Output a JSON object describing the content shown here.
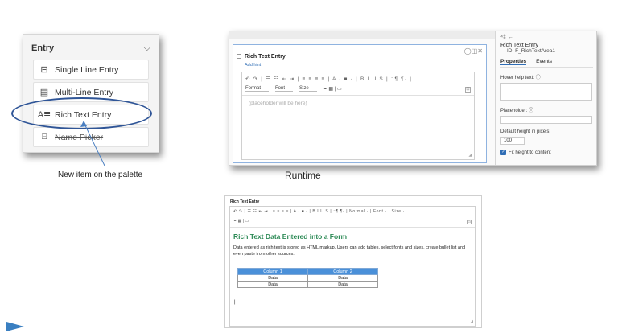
{
  "palette": {
    "title": "Entry",
    "chevron": "⌵",
    "items": [
      {
        "label": "Single Line Entry",
        "icon": "⊟"
      },
      {
        "label": "Multi-Line Entry",
        "icon": "▤"
      },
      {
        "label": "Rich Text Entry",
        "icon": "A≣"
      },
      {
        "label": "Name Picker",
        "icon": "⌸"
      }
    ],
    "caption": "New item on the palette",
    "highlight_color": "#2f5597"
  },
  "designer": {
    "top_icons": "◯◫✕",
    "field_label": "Rich Text Entry",
    "add_hint": "Add hint",
    "toolbar_row1": "↶ ↷ | ☰ ☷ ⇤ ⇥ | ≡ ≡ ≡ ≡ | A · ■ · | B I U S | ⁻¶ ¶· |",
    "format_label": "Format",
    "font_label": "Font",
    "size_label": "Size",
    "toolbar_row2_icons": "⚭ ▦ | ▭",
    "expand_icon": "⊡",
    "placeholder": "(placeholder will be here)",
    "resize_icon": "◢"
  },
  "properties": {
    "back_icon": "⁴‡ ←",
    "title": "Rich Text Entry",
    "id": "ID: F_RichTextArea1",
    "tabs": [
      "Properties",
      "Events"
    ],
    "hover_help_label": "Hover help text: ⓘ",
    "placeholder_label": "Placeholder: ⓘ",
    "default_height_label": "Default height in pixels:",
    "default_height_value": "100",
    "fit_height_label": "Fit height to content",
    "fit_height_checked": true
  },
  "runtime_label": "Runtime",
  "runtime": {
    "field_label": "Rich Text Entry",
    "toolbar_row1": "↶ ↷ | ☰ ☷ ⇤ ⇥ | ≡ ≡ ≡ ≡ | A · ■ · | B I U S | ⁻¶ ¶· | Normal · | Font · | Size ·",
    "toolbar_row2": "⚭ ▦ | ▭",
    "heading": "Rich Text Data Entered into a Form",
    "paragraph": "Data entered as rich text is stored as HTML markup.  Users can add tables, select fonts and sizes, create bullet list and even paste from other sources.",
    "table": {
      "headers": [
        "Column 1",
        "Column 2"
      ],
      "rows": [
        [
          "Data",
          "Data"
        ],
        [
          "Data",
          "Data"
        ]
      ]
    },
    "cursor": "|",
    "header_color": "#4a90d9",
    "heading_color": "#2e8b57"
  }
}
